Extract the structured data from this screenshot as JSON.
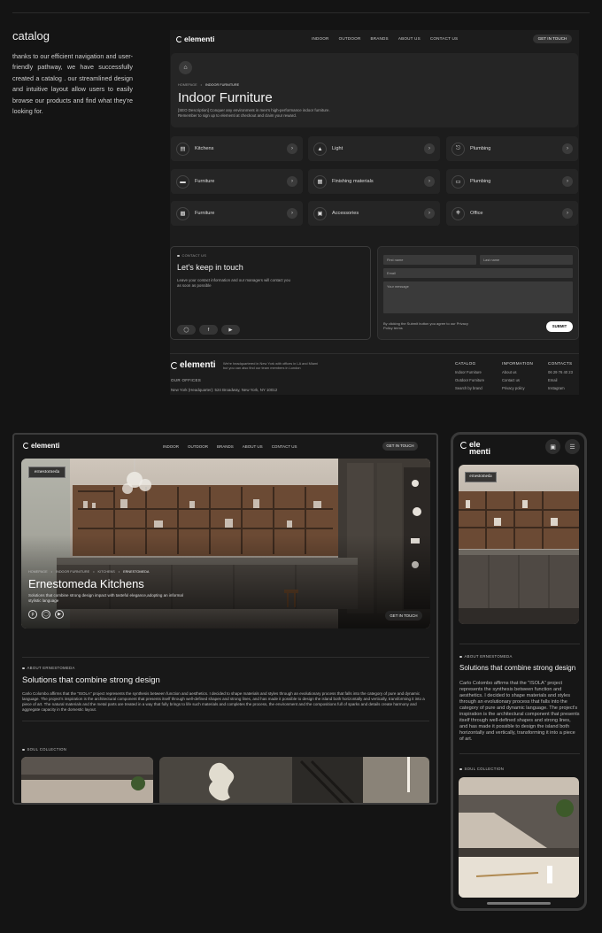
{
  "intro": {
    "title": "catalog",
    "text": "thanks to our efficient navigation and user-friendly pathway, we have successfully created a catalog . our streamlined design and intuitive layout allow users to easily browse our products and find what they're looking for."
  },
  "brand": {
    "name": "elementi",
    "mobile_line1": "ele",
    "mobile_line2": "menti"
  },
  "nav": {
    "links": [
      "INDOOR",
      "OUTDOOR",
      "BRANDS",
      "ABOUT US",
      "CONTACT US"
    ],
    "cta": "GET IN TOUCH"
  },
  "catalog": {
    "breadcrumb": [
      "HOMEPAGE",
      "INDOOR FURNITURE"
    ],
    "title": "Indoor Furniture",
    "description": "[SEO Description] Conquer any environment in men's high-performance indoor furniture. Remember to sign up to elementi at checkout and claim your reward.",
    "tiles": [
      {
        "label": "Kitchens",
        "icon": "kitchen-icon"
      },
      {
        "label": "Light",
        "icon": "lamp-icon"
      },
      {
        "label": "Plumbing",
        "icon": "faucet-icon"
      },
      {
        "label": "Furniture",
        "icon": "sofa-icon"
      },
      {
        "label": "Finishing materials",
        "icon": "tiles-icon"
      },
      {
        "label": "Plumbing",
        "icon": "sink-icon"
      },
      {
        "label": "Furniture",
        "icon": "cabinet-icon"
      },
      {
        "label": "Accessories",
        "icon": "radio-icon"
      },
      {
        "label": "Office",
        "icon": "desk-lamp-icon"
      }
    ]
  },
  "contact": {
    "label": "CONTACT US",
    "title": "Let's keep in touch",
    "text": "Leave your contact information and our managers will contact you as soon as possible",
    "form": {
      "first_name": "First name",
      "last_name": "Last name",
      "email": "Email",
      "message": "Your message",
      "note": "By clicking the Submit button you agree to our Privacy Policy terms",
      "submit": "SUBMIT"
    }
  },
  "footer": {
    "hq_text": "We're headquartered in New York with offices in LA and Miami but you can also find our team members in London",
    "offices_label": "OUR OFFICES",
    "address": "New York (Headquarter): 524 Broadway, New York, NY 10012",
    "columns": [
      {
        "title": "CATALOG",
        "items": [
          "Indoor Furniture",
          "Outdoor Furniture",
          "Search by brand"
        ]
      },
      {
        "title": "INFORMATION",
        "items": [
          "About us",
          "Contact us",
          "Privacy policy"
        ]
      },
      {
        "title": "CONTACTS",
        "items": [
          "06 29 76 40 23",
          "Email",
          "Instagram"
        ]
      }
    ]
  },
  "brand_page": {
    "tag": "ernestomeda",
    "breadcrumb": [
      "HOMEPAGE",
      "INDOOR FURNITURE",
      "KITCHENS",
      "ERNESTOMEDA"
    ],
    "title": "Ernestomeda Kitchens",
    "subtitle": "Solutions that combine strong design impact with tasteful elegance,adopting an informal stylistic language",
    "cta": "GET IN TOUCH",
    "about_label": "ABOUT ERNESTOMEDA",
    "about_title": "Solutions that combine strong design",
    "mobile_about_title": "Solutions that combine strong design",
    "about_text": "Carlo Colombo affirms that the \"ISOLA\" project represents the synthesis between function and aesthetics. I decided to shape materials and styles through an evolutionary process that falls into the category of pure and dynamic language. The project's inspiration is the architectural component that presents itself through well-defined shapes and strong lines, and has made it possible to design the island both horizontally and vertically, transforming it into a piece of art. The natural materials and the metal parts are treated in a way that fully brings to life such materials and completes the process, the environment and the compositions full of sparks and details create harmony and aggregate capacity in the domestic layout.",
    "mobile_about_text": "Carlo Colombo affirms that the \"ISOLA\" project represents the synthesis between function and aesthetics. I decided to shape materials and styles through an evolutionary process that falls into the category of pure and dynamic language. The project's inspiration is the architectural component that presents itself through well-defined shapes and strong lines, and has made it possible to design the island both horizontally and vertically, transforming it into a piece of art.",
    "collection_label": "SOUL COLLECTION"
  },
  "colors": {
    "bg": "#141414",
    "card": "#252525",
    "frame": "#3c3c3c",
    "wood": "#6b4a34"
  }
}
